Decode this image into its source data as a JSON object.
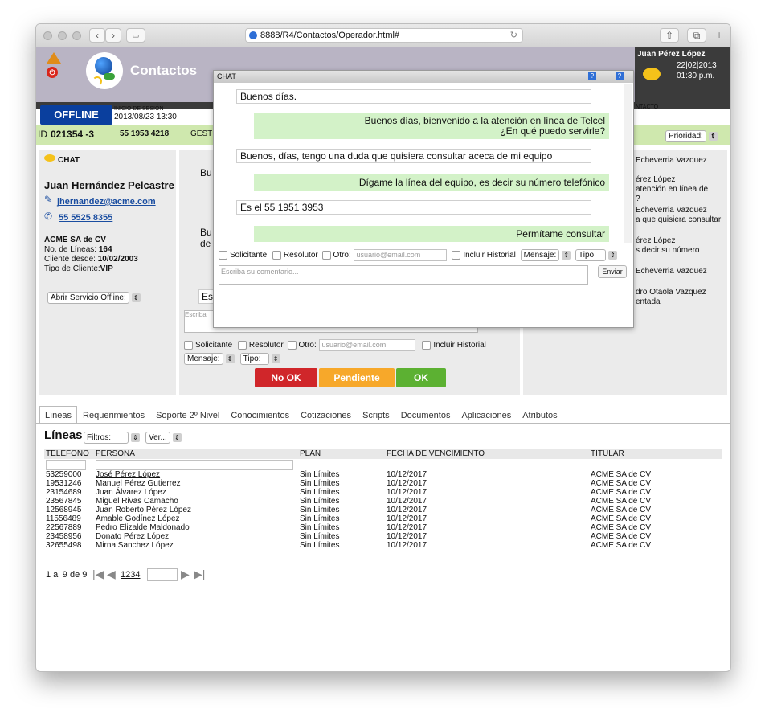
{
  "browser": {
    "url": "8888/R4/Contactos/Operador.html#"
  },
  "app": {
    "title": "Contactos",
    "user_name": "Juan Pérez López",
    "date": "22|02|2013",
    "time": "01:30 p.m.",
    "status_button": "OFFLINE",
    "session_label": "INICIO DE SESIÓN",
    "session_value": "2013/08/23 13:30",
    "contact_label": "NTACTO",
    "id_label": "ID",
    "id_value": "021354 -3",
    "phone": "55 1953 4218",
    "gest_label": "GEST",
    "priority_label": "Prioridad:"
  },
  "customer": {
    "chat_label": "CHAT",
    "name": "Juan Hernández Pelcastre",
    "email": "jhernandez@acme.com",
    "phone": "55 5525 8355",
    "company": "ACME SA de CV",
    "lines_label": "No. de Líneas:",
    "lines_value": "164",
    "since_label": "Cliente desde:",
    "since_value": "10/02/2003",
    "type_label": "Tipo de Cliente:",
    "type_value": "VIP",
    "offline_service": "Abrir Servicio Offline:"
  },
  "middle_panel": {
    "peek1": "Bu",
    "peek2a": "Bu",
    "peek2b": "de",
    "peek3": "Es",
    "comment_peek": "Escriba",
    "solicitante": "Solicitante",
    "resolutor": "Resolutor",
    "otro": "Otro:",
    "email_placeholder": "usuario@email.com",
    "historial": "Incluir Historial",
    "mensaje": "Mensaje:",
    "tipo": "Tipo:",
    "btn_nook": "No OK",
    "btn_pendiente": "Pendiente",
    "btn_ok": "OK"
  },
  "right_panel": {
    "lines": [
      "Echeverria Vazquez",
      "érez López",
      "atención en línea de",
      "?",
      "Echeverria Vazquez",
      "a que quisiera consultar",
      "érez López",
      "s decir su número",
      "Echeverria Vazquez",
      "dro Otaola Vazquez",
      "entada"
    ]
  },
  "chat": {
    "title": "CHAT",
    "messages": [
      "Buenos días.",
      "Buenos días, bienvenido a la atención en línea de Telcel",
      "¿En qué puedo servirle?",
      "Buenos, días, tengo una duda que quisiera consultar aceca de mi equipo",
      "Dígame la línea del equipo, es decir su número telefónico",
      "Es el 55 1951 3953",
      "Permítame consultar"
    ],
    "solicitante": "Solicitante",
    "resolutor": "Resolutor",
    "otro": "Otro:",
    "email_placeholder": "usuario@email.com",
    "historial": "Incluir Historial",
    "mensaje": "Mensaje:",
    "tipo": "Tipo:",
    "comment_placeholder": "Escriba su comentario...",
    "send": "Enviar",
    "help1": "?",
    "help2": "?"
  },
  "tabs": [
    "Líneas",
    "Requerimientos",
    "Soporte 2º Nivel",
    "Conocimientos",
    "Cotizaciones",
    "Scripts",
    "Documentos",
    "Aplicaciones",
    "Atributos"
  ],
  "lines_section": {
    "heading": "Líneas",
    "filters": "Filtros:",
    "ver": "Ver...",
    "columns": [
      "TELÉFONO",
      "PERSONA",
      "PLAN",
      "FECHA DE VENCIMIENTO",
      "TITULAR"
    ],
    "rows": [
      [
        "53259000",
        "José Pérez López",
        "Sin Límites",
        "10/12/2017",
        "ACME SA de CV"
      ],
      [
        "19531246",
        "Manuel Pérez Gutierrez",
        "Sin Límites",
        "10/12/2017",
        "ACME SA de CV"
      ],
      [
        "23154689",
        "Juan Álvarez López",
        "Sin Límites",
        "10/12/2017",
        "ACME SA de CV"
      ],
      [
        "23567845",
        "Miguel Rivas Camacho",
        "Sin Límites",
        "10/12/2017",
        "ACME SA de CV"
      ],
      [
        "12568945",
        "Juan Roberto Pérez López",
        "Sin Límites",
        "10/12/2017",
        "ACME SA de CV"
      ],
      [
        "11556489",
        "Amable Godínez López",
        "Sin Límites",
        "10/12/2017",
        "ACME SA de CV"
      ],
      [
        "22567889",
        "Pedro Elizalde Maldonado",
        "Sin Límites",
        "10/12/2017",
        "ACME SA de CV"
      ],
      [
        "23458956",
        "Donato Pérez López",
        "Sin Límites",
        "10/12/2017",
        "ACME SA de CV"
      ],
      [
        "32655498",
        "Mirna Sanchez López",
        "Sin Límites",
        "10/12/2017",
        "ACME SA de CV"
      ]
    ],
    "pager_text": "1 al 9 de 9",
    "pages": "1234"
  },
  "colors": {
    "header_bg": "#b9b4c4",
    "offline_btn": "#0a3f9e",
    "id_bar": "#cfe8ae",
    "btn_nook": "#d0262a",
    "btn_pendiente": "#f7a82a",
    "btn_ok": "#5cb132",
    "operator_msg": "#d3f2c8"
  }
}
